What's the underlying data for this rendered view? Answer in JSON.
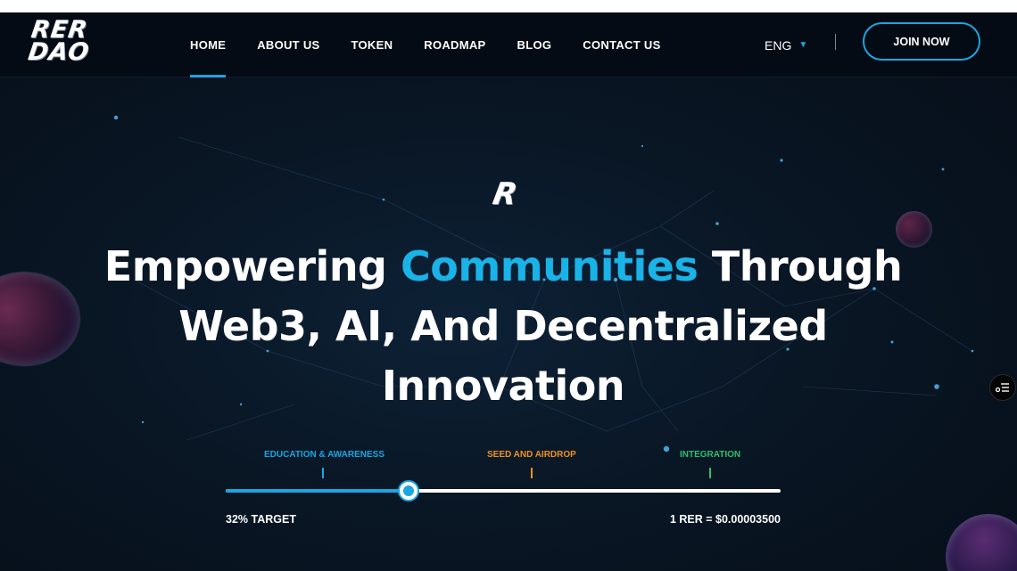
{
  "brand": {
    "logo_line1": "RER",
    "logo_line2": "DAO",
    "hero_mark": "R"
  },
  "nav": {
    "items": [
      {
        "label": "HOME",
        "active": true
      },
      {
        "label": "ABOUT US",
        "active": false
      },
      {
        "label": "TOKEN",
        "active": false
      },
      {
        "label": "ROADMAP",
        "active": false
      },
      {
        "label": "BLOG",
        "active": false
      },
      {
        "label": "CONTACT US",
        "active": false
      }
    ],
    "language": "ENG",
    "join_label": "JOIN NOW"
  },
  "hero": {
    "headline_part1": "Empowering ",
    "headline_accent": "Communities",
    "headline_part2": " Through Web3, AI, And Decentralized Innovation"
  },
  "progress": {
    "stages": [
      {
        "label": "EDUCATION & AWARENESS",
        "color": "#1aa6e0"
      },
      {
        "label": "SEED AND AIRDROP",
        "color": "#f0901e"
      },
      {
        "label": "INTEGRATION",
        "color": "#2cc070"
      }
    ],
    "percent": 33,
    "target_text": "32% TARGET",
    "price_text": "1 RER = $0.00003500"
  },
  "icons": {
    "side_button": "menu-list-icon",
    "language_chevron": "chevron-down-icon"
  },
  "colors": {
    "accent": "#1aa6e0",
    "background": "#07101c",
    "stage_orange": "#f0901e",
    "stage_green": "#2cc070"
  }
}
